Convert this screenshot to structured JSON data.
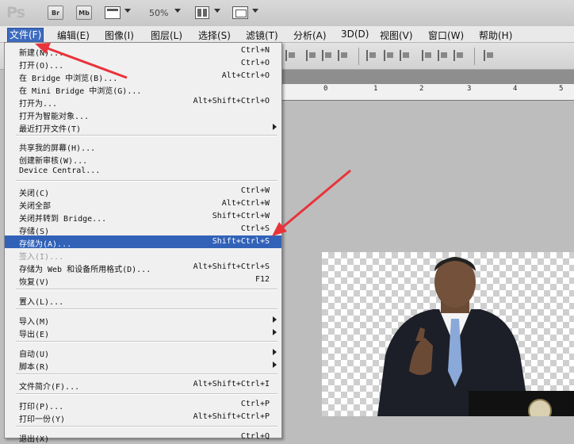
{
  "app": {
    "logo": "Ps",
    "zoom": "50%"
  },
  "toolbar": {
    "br_label": "Br",
    "mb_label": "Mb"
  },
  "menubar": [
    {
      "label": "文件(F)"
    },
    {
      "label": "编辑(E)"
    },
    {
      "label": "图像(I)"
    },
    {
      "label": "图层(L)"
    },
    {
      "label": "选择(S)"
    },
    {
      "label": "滤镜(T)"
    },
    {
      "label": "分析(A)"
    },
    {
      "label": "3D(D)"
    },
    {
      "label": "视图(V)"
    },
    {
      "label": "窗口(W)"
    },
    {
      "label": "帮助(H)"
    }
  ],
  "ruler": {
    "labels": [
      "0",
      "1",
      "2",
      "3",
      "4",
      "5"
    ]
  },
  "file_menu": {
    "items": [
      {
        "label": "新建(N)...",
        "shortcut": "Ctrl+N"
      },
      {
        "label": "打开(O)...",
        "shortcut": "Ctrl+O"
      },
      {
        "label": "在 Bridge 中浏览(B)...",
        "shortcut": "Alt+Ctrl+O"
      },
      {
        "label": "在 Mini Bridge 中浏览(G)...",
        "shortcut": ""
      },
      {
        "label": "打开为...",
        "shortcut": "Alt+Shift+Ctrl+O"
      },
      {
        "label": "打开为智能对象...",
        "shortcut": ""
      },
      {
        "label": "最近打开文件(T)",
        "shortcut": ""
      },
      {
        "label": "共享我的屏幕(H)...",
        "shortcut": ""
      },
      {
        "label": "创建新审核(W)...",
        "shortcut": ""
      },
      {
        "label": "Device Central...",
        "shortcut": ""
      },
      {
        "label": "关闭(C)",
        "shortcut": "Ctrl+W"
      },
      {
        "label": "关闭全部",
        "shortcut": "Alt+Ctrl+W"
      },
      {
        "label": "关闭并转到 Bridge...",
        "shortcut": "Shift+Ctrl+W"
      },
      {
        "label": "存储(S)",
        "shortcut": "Ctrl+S"
      },
      {
        "label": "存储为(A)...",
        "shortcut": "Shift+Ctrl+S"
      },
      {
        "label": "签入(I)...",
        "shortcut": ""
      },
      {
        "label": "存储为 Web 和设备所用格式(D)...",
        "shortcut": "Alt+Shift+Ctrl+S"
      },
      {
        "label": "恢复(V)",
        "shortcut": "F12"
      },
      {
        "label": "置入(L)...",
        "shortcut": ""
      },
      {
        "label": "导入(M)",
        "shortcut": ""
      },
      {
        "label": "导出(E)",
        "shortcut": ""
      },
      {
        "label": "自动(U)",
        "shortcut": ""
      },
      {
        "label": "脚本(R)",
        "shortcut": ""
      },
      {
        "label": "文件简介(F)...",
        "shortcut": "Alt+Shift+Ctrl+I"
      },
      {
        "label": "打印(P)...",
        "shortcut": "Ctrl+P"
      },
      {
        "label": "打印一份(Y)",
        "shortcut": "Alt+Shift+Ctrl+P"
      },
      {
        "label": "退出(X)",
        "shortcut": "Ctrl+Q"
      }
    ]
  },
  "colors": {
    "menu_highlight": "#3162b8",
    "annotation_arrow": "#e8333a"
  }
}
